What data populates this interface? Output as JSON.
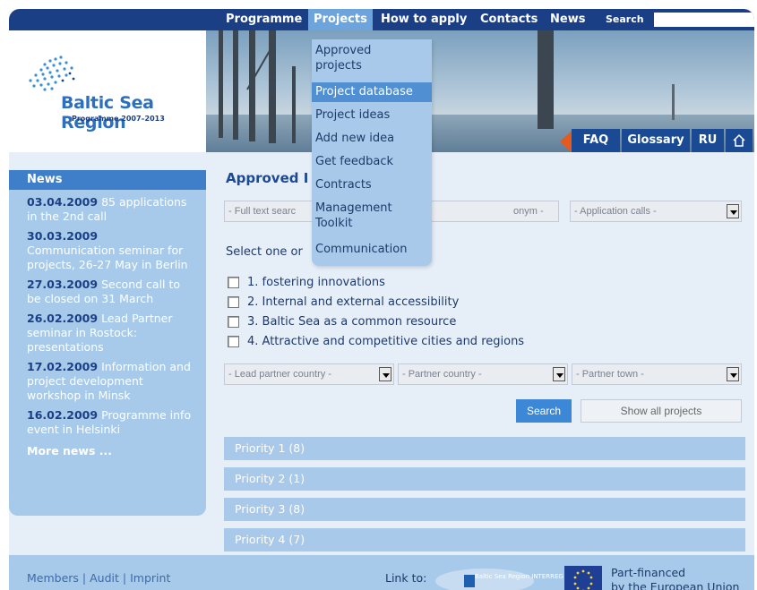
{
  "topnav": {
    "items": [
      "Programme",
      "Projects",
      "How to apply",
      "Contacts",
      "News"
    ],
    "active": "Projects",
    "search_label": "Search",
    "search_value": ""
  },
  "header": {
    "logo_title": "Baltic Sea Region",
    "logo_subtitle": "Programme 2007–2013",
    "buttons": [
      "FAQ",
      "Glossary",
      "RU"
    ],
    "home_icon": "home-icon"
  },
  "dropdown": {
    "items": [
      "Approved projects",
      "Project database",
      "Project ideas",
      "Add new idea",
      "Get feedback",
      "Contracts",
      "Management Toolkit",
      "Communication"
    ],
    "selected": "Project database"
  },
  "news": {
    "heading": "News",
    "items": [
      {
        "date": "03.04.2009",
        "text": "85 applications in the 2nd call"
      },
      {
        "date": "30.03.2009",
        "text": "Communication seminar for projects, 26-27 May in Berlin"
      },
      {
        "date": "27.03.2009",
        "text": "Second call to be closed on 31 March"
      },
      {
        "date": "26.02.2009",
        "text": "Lead Partner seminar in Rostock: presentations"
      },
      {
        "date": "17.02.2009",
        "text": "Information and project development workshop in Minsk"
      },
      {
        "date": "16.02.2009",
        "text": "Programme info event in Helsinki"
      }
    ],
    "more": "More news ..."
  },
  "main": {
    "title": "Approved I",
    "fulltext_placeholder": "- Full text searc",
    "acronym_placeholder": "onym -",
    "application_calls": "- Application calls -",
    "select_prompt": "Select one or",
    "priorities_checks": [
      "1. fostering innovations",
      "2. Internal and external accessibility",
      "3. Baltic Sea as a common resource",
      "4. Attractive and competitive cities and regions"
    ],
    "lead_partner_country": "- Lead partner country -",
    "partner_country": "- Partner country -",
    "partner_town": "- Partner town -",
    "search_button": "Search",
    "show_all_button": "Show all projects",
    "priority_bars": [
      "Priority 1 (8)",
      "Priority 2 (1)",
      "Priority 3 (8)",
      "Priority 4 (7)"
    ]
  },
  "footer": {
    "links": [
      "Members",
      "Audit",
      "Imprint"
    ],
    "separator": "|",
    "link_to": "Link to:",
    "bsr_logo_text": "Baltic Sea Region INTERREG III B",
    "eu_text_line1": "Part-financed",
    "eu_text_line2": "by the European Union"
  },
  "colors": {
    "nav_bg": "#1b3f85",
    "accent": "#3f7fc9",
    "light_blue": "#a7caea",
    "menu_selected": "#4f8fd2"
  }
}
